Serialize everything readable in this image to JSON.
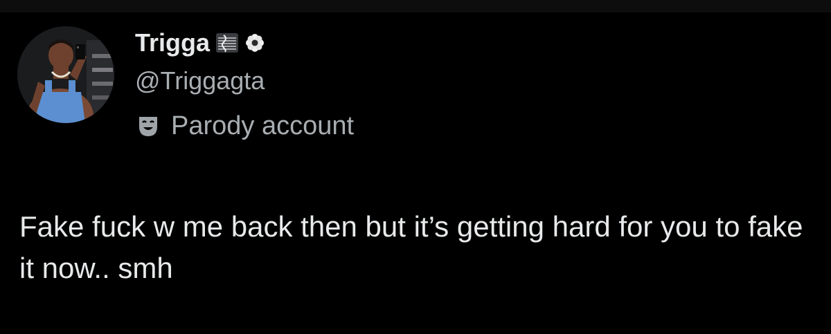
{
  "author": {
    "display_name": "Trigga",
    "display_name_emojis": [
      "sheet-music-emoji",
      "flower-emoji"
    ],
    "handle": "@Triggagta",
    "label_icon": "parody-mask-icon",
    "label_text": "Parody account"
  },
  "tweet": {
    "text": "Fake fuck w me back then but it’s getting hard for you to fake it now.. smh"
  },
  "colors": {
    "background": "#000000",
    "primary_text": "#e7e9ea",
    "secondary_text": "#a9aeb2"
  }
}
